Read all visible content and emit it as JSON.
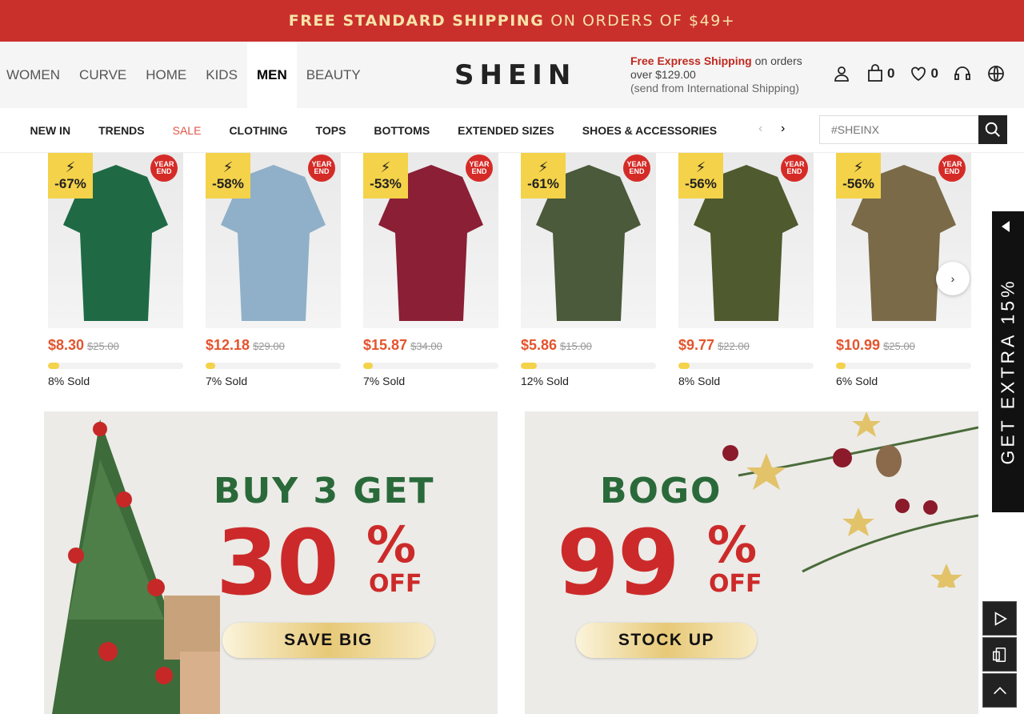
{
  "promo": {
    "bold": "FREE STANDARD SHIPPING",
    "rest": "ON ORDERS OF $49+"
  },
  "header": {
    "categories": [
      "WOMEN",
      "CURVE",
      "HOME",
      "KIDS",
      "MEN",
      "BEAUTY"
    ],
    "active_category": "MEN",
    "logo": "SHEIN",
    "shipping": {
      "highlight": "Free Express Shipping",
      "line1_rest": " on orders",
      "line2": "over $129.00",
      "line3": "(send from International Shipping)"
    },
    "cart_count": "0",
    "wishlist_count": "0",
    "icons": [
      "user-icon",
      "bag-icon",
      "heart-icon",
      "headset-icon",
      "globe-icon"
    ]
  },
  "subnav": {
    "items": [
      "NEW IN",
      "TRENDS",
      "SALE",
      "CLOTHING",
      "TOPS",
      "BOTTOMS",
      "EXTENDED SIZES",
      "SHOES & ACCESSORIES"
    ],
    "search_placeholder": "#SHEINX"
  },
  "products": [
    {
      "discount": "-67%",
      "badge": "YEAR END",
      "price": "$8.30",
      "original": "$25.00",
      "sold_pct": 8,
      "sold": "8% Sold",
      "color": "#1f6a45"
    },
    {
      "discount": "-58%",
      "badge": "YEAR END",
      "price": "$12.18",
      "original": "$29.00",
      "sold_pct": 7,
      "sold": "7% Sold",
      "color": "#8fb0c8"
    },
    {
      "discount": "-53%",
      "badge": "YEAR END",
      "price": "$15.87",
      "original": "$34.00",
      "sold_pct": 7,
      "sold": "7% Sold",
      "color": "#8a1f35"
    },
    {
      "discount": "-61%",
      "badge": "YEAR END",
      "price": "$5.86",
      "original": "$15.00",
      "sold_pct": 12,
      "sold": "12% Sold",
      "color": "#4a5a3a"
    },
    {
      "discount": "-56%",
      "badge": "YEAR END",
      "price": "$9.77",
      "original": "$22.00",
      "sold_pct": 8,
      "sold": "8% Sold",
      "color": "#4f5a2e"
    },
    {
      "discount": "-56%",
      "badge": "YEAR END",
      "price": "$10.99",
      "original": "$25.00",
      "sold_pct": 6,
      "sold": "6% Sold",
      "color": "#7a6a48"
    }
  ],
  "banners": [
    {
      "headline": "BUY 3 GET",
      "big": "30",
      "pct": "%",
      "off": "OFF",
      "button": "SAVE BIG"
    },
    {
      "headline": "BOGO",
      "big": "99",
      "pct": "%",
      "off": "OFF",
      "button": "STOCK UP"
    }
  ],
  "side_tab": "GET EXTRA 15%",
  "colors": {
    "promo_bg": "#c9302c",
    "price": "#e4542d",
    "badge": "#f4d24a",
    "green": "#2a6a3a",
    "red": "#cc2a2a"
  }
}
